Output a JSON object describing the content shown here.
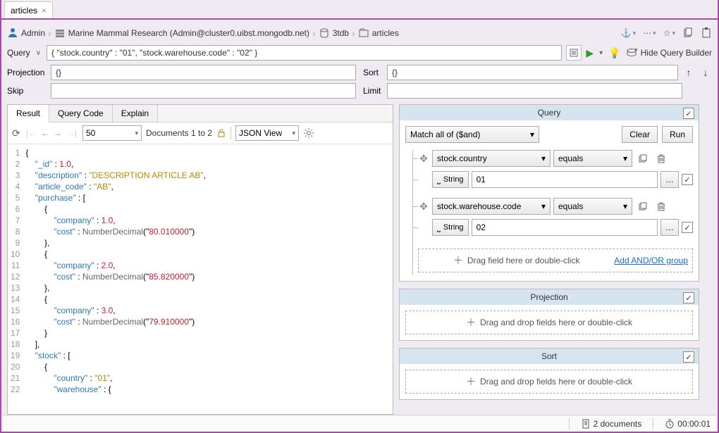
{
  "tab": {
    "title": "articles"
  },
  "breadcrumb": {
    "user": "Admin",
    "connection": "Marine Mammal Research (Admin@cluster0.uibst.mongodb.net)",
    "database": "3tdb",
    "collection": "articles"
  },
  "query_bar": {
    "label": "Query",
    "value": "{ \"stock.country\" : \"01\", \"stock.warehouse.code\" : \"02\" }",
    "hide_builder": "Hide Query Builder"
  },
  "projection": {
    "label": "Projection",
    "value": "{}"
  },
  "sort_input": {
    "label": "Sort",
    "value": "{}"
  },
  "skip": {
    "label": "Skip",
    "value": ""
  },
  "limit": {
    "label": "Limit",
    "value": ""
  },
  "left_tabs": {
    "result": "Result",
    "query_code": "Query Code",
    "explain": "Explain"
  },
  "result_toolbar": {
    "page_size": "50",
    "doc_range": "Documents 1 to 2",
    "view_mode": "JSON View"
  },
  "code_lines": [
    "{",
    "    \"_id\" : 1.0,",
    "    \"description\" : \"DESCRIPTION ARTICLE AB\",",
    "    \"article_code\" : \"AB\",",
    "    \"purchase\" : [",
    "        {",
    "            \"company\" : 1.0,",
    "            \"cost\" : NumberDecimal(\"80.010000\")",
    "        },",
    "        {",
    "            \"company\" : 2.0,",
    "            \"cost\" : NumberDecimal(\"85.820000\")",
    "        },",
    "        {",
    "            \"company\" : 3.0,",
    "            \"cost\" : NumberDecimal(\"79.910000\")",
    "        }",
    "    ],",
    "    \"stock\" : [",
    "        {",
    "            \"country\" : \"01\",",
    "            \"warehouse\" : {"
  ],
  "query_builder": {
    "header": "Query",
    "match_mode": "Match all of ($and)",
    "clear": "Clear",
    "run": "Run",
    "conditions": [
      {
        "field": "stock.country",
        "operator": "equals",
        "type": "String",
        "value": "01"
      },
      {
        "field": "stock.warehouse.code",
        "operator": "equals",
        "type": "String",
        "value": "02"
      }
    ],
    "drag_hint": "Drag field here or double-click",
    "add_group": "Add AND/OR group"
  },
  "projection_builder": {
    "header": "Projection",
    "drag_hint": "Drag and drop fields here or double-click"
  },
  "sort_builder": {
    "header": "Sort",
    "drag_hint": "Drag and drop fields here or double-click"
  },
  "status": {
    "doc_count": "2 documents",
    "elapsed": "00:00:01"
  }
}
